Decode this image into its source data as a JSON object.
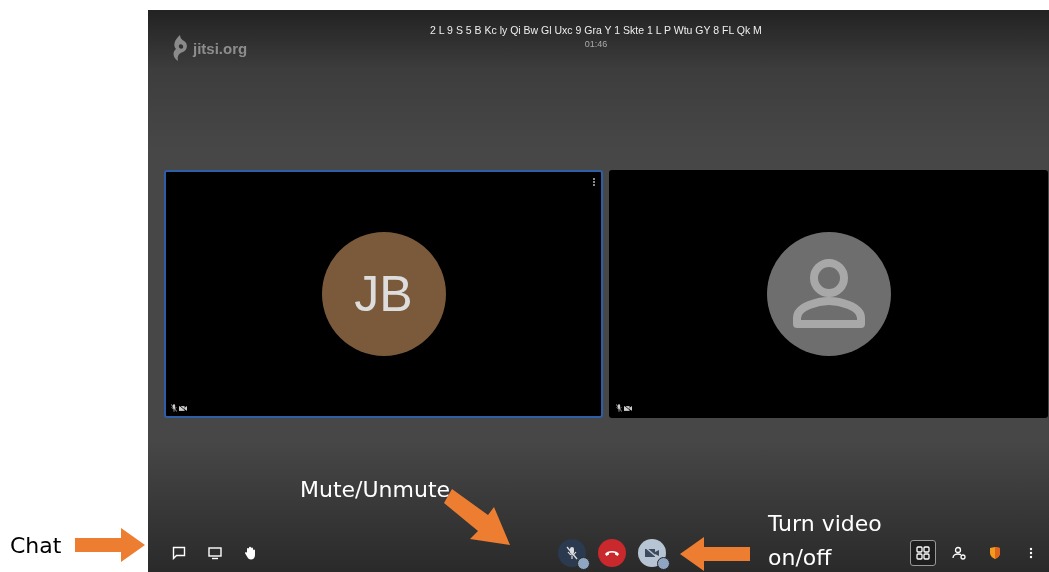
{
  "header": {
    "logo": "jitsi.org",
    "meeting_name": "2 L 9 S 5 B Kc ly Qi Bw Gl Uxc 9 Gra Y 1 Skte 1 L P Wtu GY 8 FL Qk M",
    "timer": "01:46"
  },
  "tiles": [
    {
      "kind": "initials",
      "initials": "JB",
      "selected": true,
      "audio_muted": true,
      "video_muted": true
    },
    {
      "kind": "placeholder",
      "selected": false,
      "audio_muted": true,
      "video_muted": true
    }
  ],
  "toolbar": {
    "left": [
      {
        "kind": "chat"
      },
      {
        "kind": "screen"
      },
      {
        "kind": "hand"
      }
    ],
    "center": [
      {
        "kind": "mic",
        "muted": true
      },
      {
        "kind": "hangup"
      },
      {
        "kind": "camera",
        "muted": true
      }
    ],
    "right": [
      {
        "kind": "tiles",
        "selected": true
      },
      {
        "kind": "participants",
        "selected": false
      },
      {
        "kind": "security",
        "selected": false
      },
      {
        "kind": "more",
        "selected": false
      }
    ]
  },
  "annotations": [
    {
      "label": "Chat",
      "kind": "arrow-right"
    },
    {
      "label": "Mute/Unmute",
      "kind": "arrow-down-right"
    },
    {
      "label": "Turn video on/off",
      "kind": "arrow-left"
    }
  ]
}
